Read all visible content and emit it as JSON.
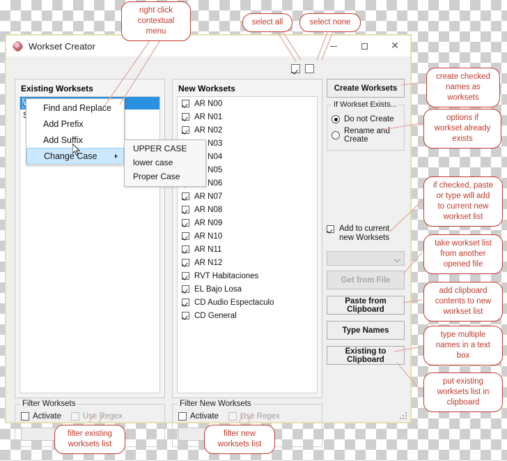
{
  "window": {
    "title": "Workset Creator",
    "icon": "revit-app-icon",
    "minimize_label": "–",
    "maximize_label": "☐",
    "close_label": "✕"
  },
  "top_controls": {
    "select_all": {
      "name": "select-all-checkbox",
      "checked": true
    },
    "select_none": {
      "name": "select-none-checkbox",
      "checked": false
    }
  },
  "existing_panel": {
    "title": "Existing Worksets",
    "items": [
      {
        "label": "Workset1",
        "selected": true
      },
      {
        "label": "Sh",
        "selected": false
      }
    ]
  },
  "new_panel": {
    "title": "New Worksets",
    "items": [
      {
        "label": "AR N00",
        "checked": true
      },
      {
        "label": "AR N01",
        "checked": true
      },
      {
        "label": "AR N02",
        "checked": true
      },
      {
        "label": "AR N03",
        "checked": true
      },
      {
        "label": "AR N04",
        "checked": true
      },
      {
        "label": "AR N05",
        "checked": true
      },
      {
        "label": "AR N06",
        "checked": true
      },
      {
        "label": "AR N07",
        "checked": true
      },
      {
        "label": "AR N08",
        "checked": true
      },
      {
        "label": "AR N09",
        "checked": true
      },
      {
        "label": "AR N10",
        "checked": true
      },
      {
        "label": "AR N11",
        "checked": true
      },
      {
        "label": "AR N12",
        "checked": true
      },
      {
        "label": "RVT Habitaciones",
        "checked": true
      },
      {
        "label": "EL Bajo Losa",
        "checked": true
      },
      {
        "label": "CD Audio Espectaculo",
        "checked": true
      },
      {
        "label": "CD General",
        "checked": true
      }
    ]
  },
  "right_column": {
    "create_button": "Create Worksets",
    "exists_group": {
      "label": "If Workset Exists...",
      "options": [
        {
          "label": "Do not Create",
          "selected": true
        },
        {
          "label": "Rename and Create",
          "selected": false
        }
      ]
    },
    "add_to_current": {
      "label_line1": "Add to current",
      "label_line2": "new Worksets",
      "checked": true
    },
    "file_combo": {
      "value": "",
      "placeholder": ""
    },
    "get_from_file_button": {
      "label": "Get from File",
      "disabled": true
    },
    "paste_clipboard_button": "Paste from Clipboard",
    "type_names_button": "Type Names",
    "existing_to_clipboard_button": "Existing to Clipboard"
  },
  "filter_existing": {
    "label": "Filter Worksets",
    "activate": {
      "label": "Activate",
      "checked": false
    },
    "use_regex": {
      "label": "Use Regex",
      "checked": false,
      "disabled": true
    },
    "text": {
      "value": "",
      "placeholder": ""
    }
  },
  "filter_new": {
    "label": "Filter New Worksets",
    "activate": {
      "label": "Activate",
      "checked": false
    },
    "use_regex": {
      "label": "Use Regex",
      "checked": false,
      "disabled": true
    },
    "text": {
      "value": "",
      "placeholder": ""
    }
  },
  "context_menu": {
    "items": [
      {
        "label": "Find and Replace",
        "highlighted": false,
        "has_submenu": false
      },
      {
        "label": "Add Prefix",
        "highlighted": false,
        "has_submenu": false
      },
      {
        "label": "Add Suffix",
        "highlighted": false,
        "has_submenu": false
      },
      {
        "label": "Change Case",
        "highlighted": true,
        "has_submenu": true
      }
    ],
    "submenu": {
      "items": [
        "UPPER CASE",
        "lower case",
        "Proper Case"
      ]
    }
  },
  "callouts": [
    {
      "id": "right-click-menu",
      "text": "right click\ncontextual menu"
    },
    {
      "id": "select-all",
      "text": "select all"
    },
    {
      "id": "select-none",
      "text": "select none"
    },
    {
      "id": "create-checked",
      "text": "create checked\nnames as\nworksets"
    },
    {
      "id": "options-if-exists",
      "text": "options if\nworkset already\nexists"
    },
    {
      "id": "if-checked-paste",
      "text": "if checked, paste\nor type will add\nto current new\nworkset list"
    },
    {
      "id": "take-from-another-file",
      "text": "take workset list\nfrom another\nopened file"
    },
    {
      "id": "add-clipboard",
      "text": "add clipboard\ncontents to new\nworkset list"
    },
    {
      "id": "type-multiple-names",
      "text": "type multiple\nnames in a text\nbox"
    },
    {
      "id": "put-existing-clipboard",
      "text": "put existing\nworksets list in\nclipboard"
    },
    {
      "id": "filter-existing-list",
      "text": "filter existing\nworksets list"
    },
    {
      "id": "filter-new-list",
      "text": "filter new\nworksets list"
    }
  ],
  "colors": {
    "callout_red": "#c0392b",
    "selection_blue": "#2a90e0",
    "menu_highlight": "#cce8ff",
    "window_chrome": "#f0f0f0"
  }
}
